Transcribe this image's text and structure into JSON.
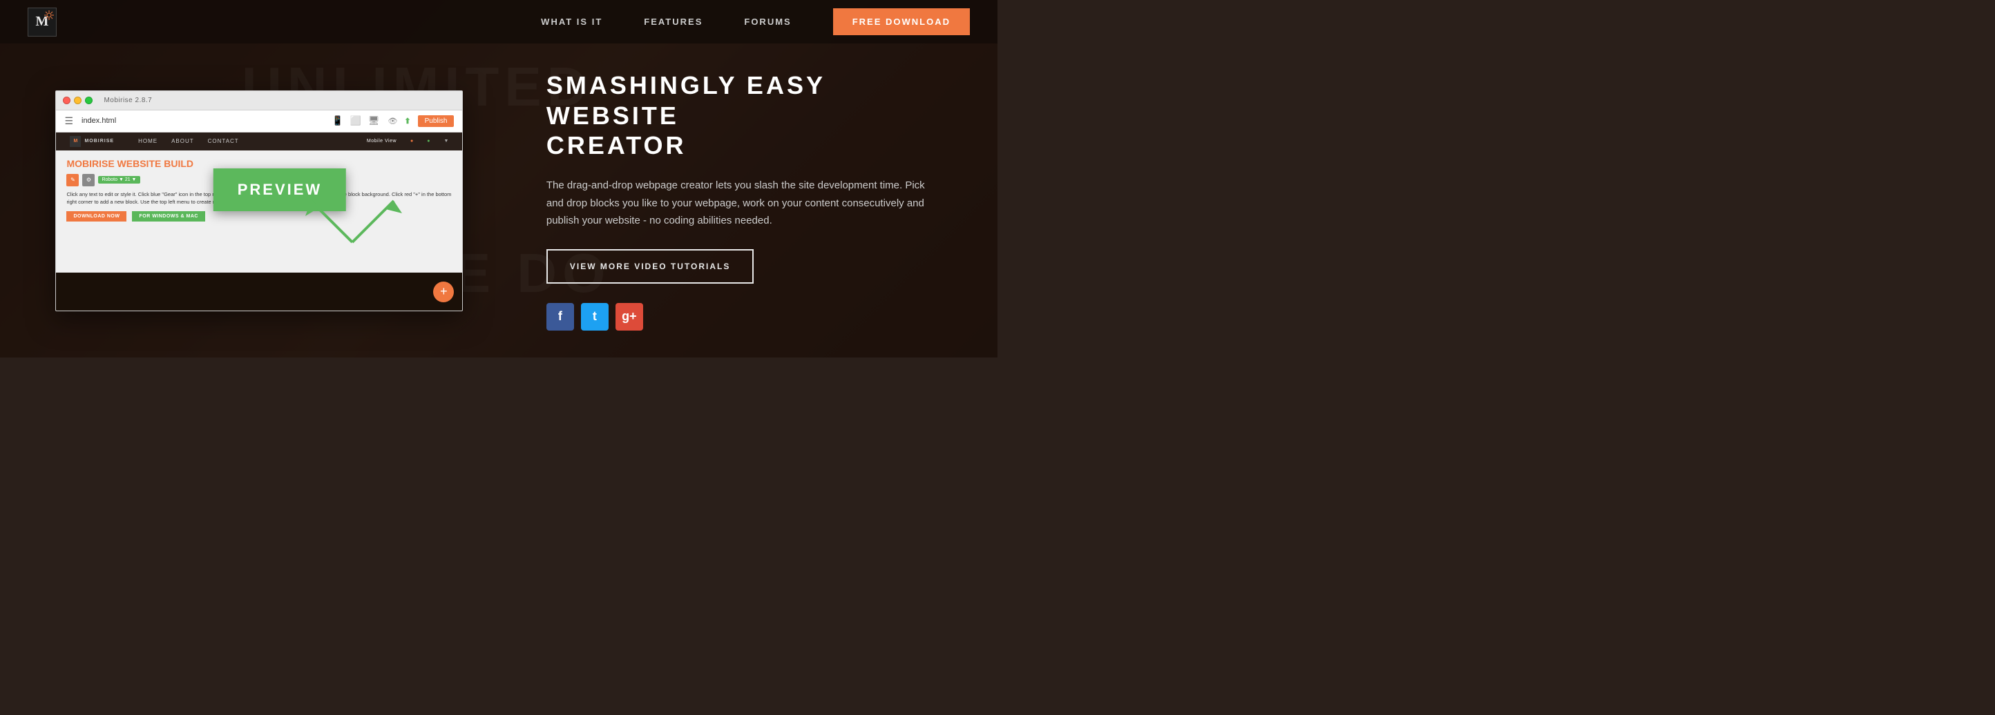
{
  "navbar": {
    "logo_letter": "M",
    "nav_links": [
      {
        "label": "WHAT IS IT",
        "id": "what-is-it"
      },
      {
        "label": "FEATURES",
        "id": "features"
      },
      {
        "label": "FORUMS",
        "id": "forums"
      }
    ],
    "cta_label": "FREE DOWNLOAD"
  },
  "background": {
    "text1": "UNLIMITED",
    "text2": "PLEASE DO"
  },
  "app_window": {
    "title": "Mobirise 2.8.7",
    "filename": "index.html",
    "mobile_view": "Mobile View",
    "nav_items": [
      "HOME",
      "ABOUT",
      "CONTACT"
    ],
    "brand": "MOBIRISE",
    "heading": "MOBIRISE WEBSITE BUILD",
    "body_text": "Click any text to edit or style it. Click blue \"Gear\" icon in the top right corner to hide/show buttons, text, title and change the block background.\nClick red \"+\" in the bottom right corner to add a new block.\nUse the top left menu to create new pages, sites and add extensions.",
    "btn1": "DOWNLOAD NOW",
    "btn2": "FOR WINDOWS & MAC",
    "publish_label": "Publish"
  },
  "preview": {
    "label": "PREVIEW"
  },
  "right_panel": {
    "heading_line1": "SMASHINGLY EASY WEBSITE",
    "heading_line2": "CREATOR",
    "description": "The drag-and-drop webpage creator lets you slash the site development time. Pick and drop blocks you like to your webpage, work on your content consecutively and publish your website - no coding abilities needed.",
    "tutorials_btn": "VIEW MORE VIDEO TUTORIALS",
    "social": [
      {
        "name": "facebook",
        "label": "f"
      },
      {
        "name": "twitter",
        "label": "t"
      },
      {
        "name": "google-plus",
        "label": "g+"
      }
    ]
  },
  "platforms": {
    "label": "for Windows Mac"
  }
}
